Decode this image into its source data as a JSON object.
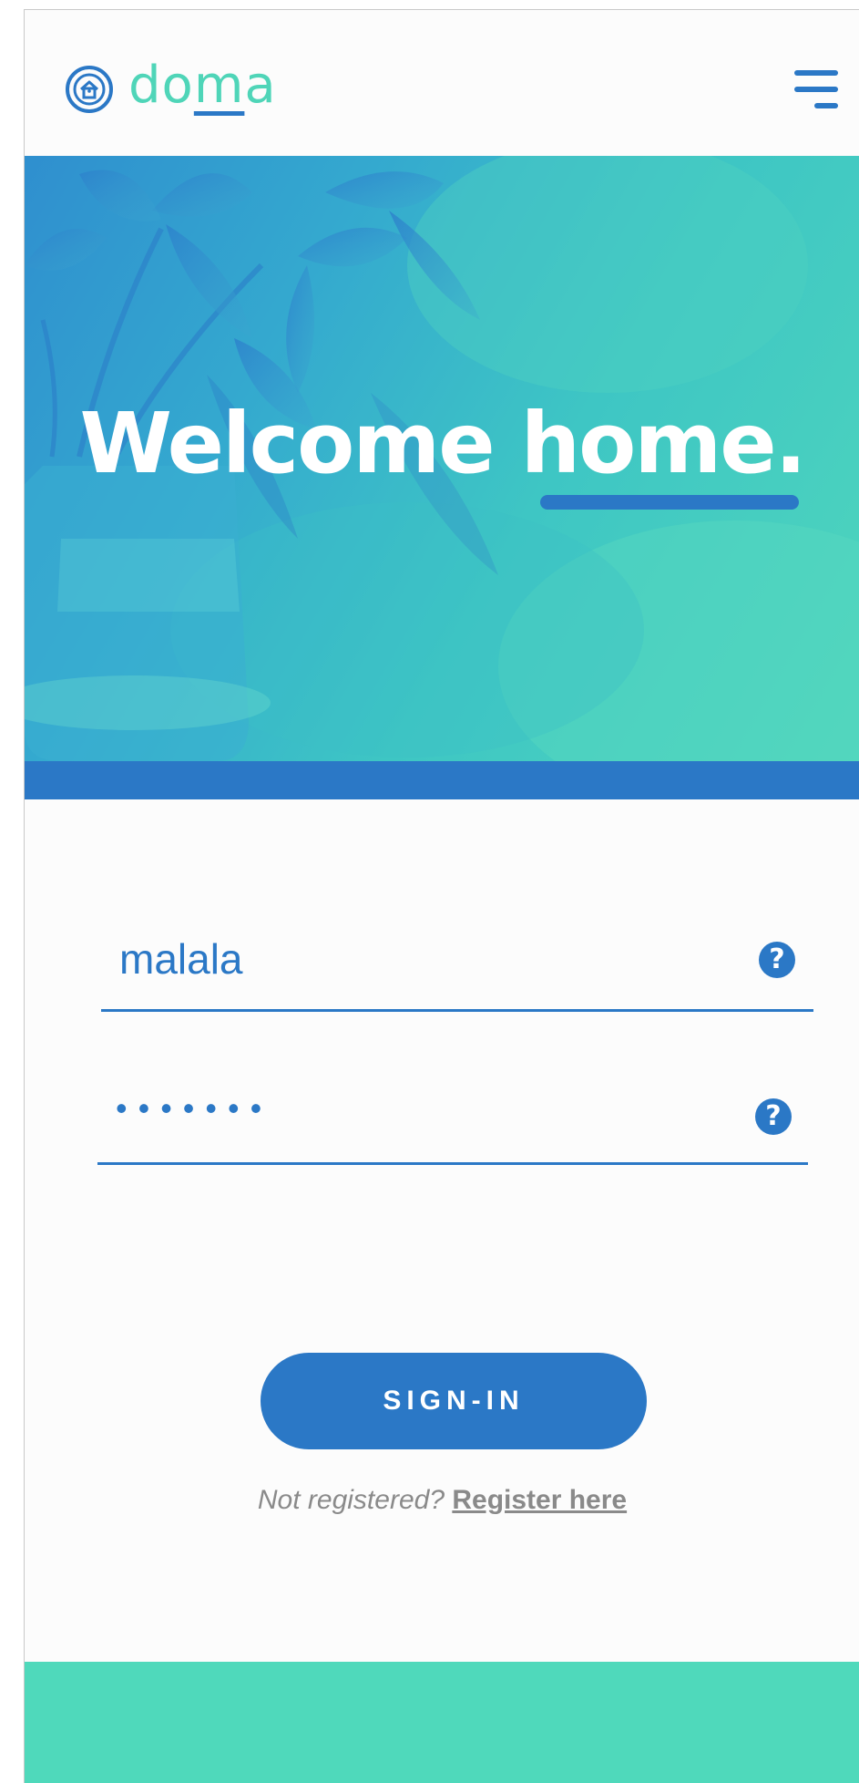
{
  "brand": {
    "name": "doma",
    "logo_icon": "house-in-circle-icon",
    "primary_color": "#2b78c6",
    "accent_color": "#4fd5b8"
  },
  "header": {
    "menu_icon": "hamburger-menu-icon"
  },
  "hero": {
    "title_prefix": "Welcome ",
    "title_emphasis": "home."
  },
  "login_form": {
    "username": {
      "value": "malala",
      "help_icon": "question-circle-icon",
      "help_glyph": "?"
    },
    "password": {
      "value": "•••••••",
      "help_icon": "question-circle-icon",
      "help_glyph": "?"
    },
    "submit_label": "SIGN-IN",
    "register_prompt": "Not registered?",
    "register_link": "Register here"
  }
}
